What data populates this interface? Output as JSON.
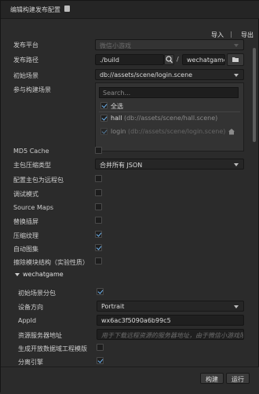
{
  "window": {
    "title": "编辑构建发布配置"
  },
  "toolbar": {
    "import_label": "导入",
    "export_label": "导出"
  },
  "form": {
    "platform": {
      "label": "发布平台",
      "value": "微信小游戏"
    },
    "path": {
      "label": "发布路径",
      "value": "./build",
      "dir_value": "wechatgame",
      "separator": "/"
    },
    "start_scene": {
      "label": "初始场景",
      "value": "db://assets/scene/login.scene"
    },
    "scenes": {
      "label": "参与构建场景",
      "search_placeholder": "Search...",
      "select_all_label": "全选",
      "items": [
        {
          "name": "hall",
          "path": "(db://assets/scene/hall.scene)",
          "checked": true
        },
        {
          "name": "login",
          "path": "(db://assets/scene/login.scene)",
          "checked": true
        }
      ]
    },
    "md5_cache": {
      "label": "MD5 Cache",
      "checked": false
    },
    "main_compress": {
      "label": "主包压缩类型",
      "value": "合并所有 JSON"
    },
    "main_remote": {
      "label": "配置主包为远程包",
      "checked": false
    },
    "debug": {
      "label": "调试模式",
      "checked": false
    },
    "source_maps": {
      "label": "Source Maps",
      "checked": false
    },
    "replace_splash": {
      "label": "替换插屏",
      "checked": false
    },
    "compress_texture": {
      "label": "压缩纹理",
      "checked": true
    },
    "auto_atlas": {
      "label": "自动图集",
      "checked": true
    },
    "erase_modules": {
      "label": "擦除模块结构（实验性质）",
      "checked": false
    }
  },
  "wechat": {
    "section_label": "wechatgame",
    "initial_subpackage": {
      "label": "初始场景分包",
      "checked": true
    },
    "orientation": {
      "label": "设备方向",
      "value": "Portrait"
    },
    "appid": {
      "label": "AppId",
      "value": "wx6ac3f5090a6b99c5"
    },
    "remote_server": {
      "label": "资源服务器地址",
      "placeholder": "用于下载远程资源的服务器地址，由于微信小游戏限制…"
    },
    "open_data": {
      "label": "生成开放数据域工程模版",
      "checked": false
    },
    "separate_engine": {
      "label": "分离引擎",
      "checked": true
    }
  },
  "actions": {
    "build_label": "构建",
    "run_label": "运行"
  },
  "icons": {
    "zoom": "magnifier-icon",
    "folder": "folder-icon",
    "home": "home-icon",
    "lock": "lock-icon"
  },
  "colors": {
    "accent": "#6fb4f0",
    "bg": "#2b2b2b",
    "field_bg": "#1f1f1f"
  }
}
